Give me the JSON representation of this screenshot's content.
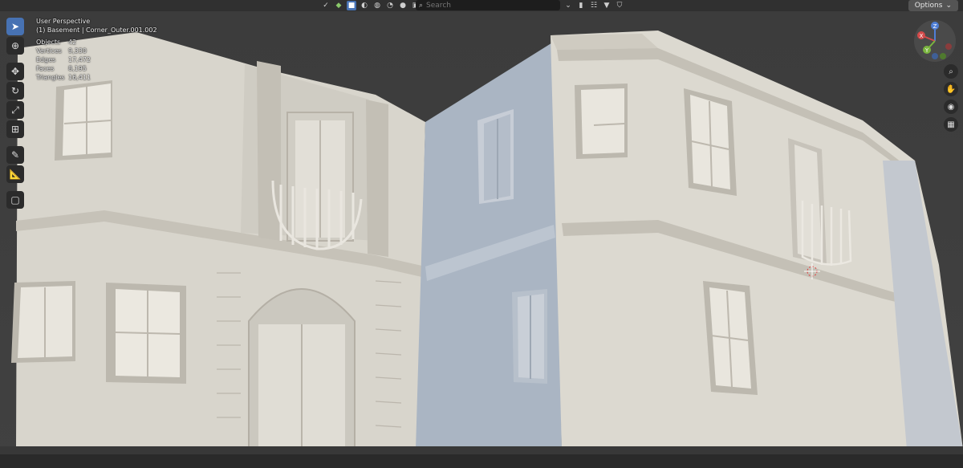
{
  "viewport": {
    "perspective_label": "User Perspective",
    "object_label": "(1) Basement | Corner_Outer.001.002",
    "stats": [
      {
        "label": "Objects",
        "value": "42"
      },
      {
        "label": "Vertices",
        "value": "9,330"
      },
      {
        "label": "Edges",
        "value": "17,472"
      },
      {
        "label": "Faces",
        "value": "8,195"
      },
      {
        "label": "Triangles",
        "value": "16,411"
      }
    ]
  },
  "header": {
    "search_placeholder": "Search",
    "options_label": "Options"
  },
  "gizmo": {
    "z_label": "Z",
    "x_label": "X",
    "y_label": "Y"
  },
  "colors": {
    "accent": "#4772b3",
    "building_light": "#dcd9d0",
    "building_shadow": "#a9b4c2",
    "background": "#3d3d3d"
  },
  "icons": {
    "toolbar": [
      "select-box-icon",
      "cursor-icon",
      "move-icon",
      "rotate-icon",
      "scale-icon",
      "transform-icon",
      "annotate-icon",
      "measure-icon",
      "add-cube-icon"
    ],
    "nav": [
      "zoom-icon",
      "hand-icon",
      "camera-icon",
      "grid-icon"
    ]
  }
}
